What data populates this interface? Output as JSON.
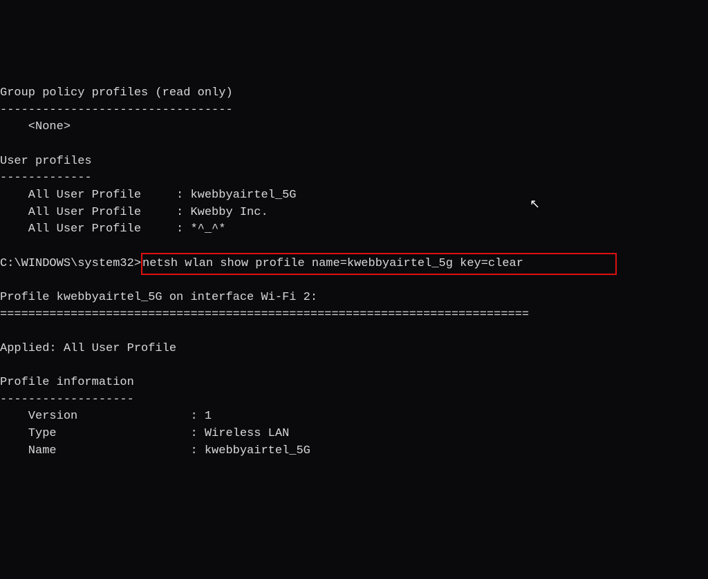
{
  "header_group": "Group policy profiles (read only)",
  "header_dash1": "---------------------------------",
  "none_line": "    <None>",
  "header_user": "User profiles",
  "header_dash2": "-------------",
  "profiles": [
    {
      "label": "    All User Profile     : kwebbyairtel_5G"
    },
    {
      "label": "    All User Profile     : Kwebby Inc."
    },
    {
      "label": "    All User Profile     : *^_^*"
    }
  ],
  "prompt_prefix": "C:\\WINDOWS\\system32>",
  "command": "netsh wlan show profile name=kwebbyairtel_5g key=clear             ",
  "out_title": "Profile kwebbyairtel_5G on interface Wi-Fi 2:",
  "out_sep": "===========================================================================",
  "applied": "Applied: All User Profile",
  "pi_header": "Profile information",
  "pi_dash": "-------------------",
  "pi": [
    {
      "label": "    Version                : 1"
    },
    {
      "label": "    Type                   : Wireless LAN"
    },
    {
      "label": "    Name                   : kwebbyairtel_5G"
    }
  ]
}
